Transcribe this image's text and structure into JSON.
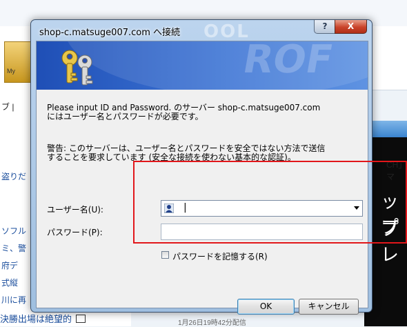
{
  "background": {
    "logo_tab": "My",
    "left_rows": [
      "ブ |",
      "盗りだ",
      "ソフル",
      "ミ、警",
      "府デ",
      "式縦",
      "川に再"
    ],
    "right_text": "CH」マ",
    "right_big": [
      "ップ",
      "プレ"
    ],
    "bottom_link": "決勝出場は絶望的",
    "bottom_meta": "1月26日19時42分配信"
  },
  "dialog": {
    "title": "shop-c.matsuge007.com へ接続",
    "help_label": "?",
    "close_label": "X",
    "message_line1": "Please input ID and Password. のサーバー shop-c.matsuge007.com",
    "message_line2": "にはユーザー名とパスワードが必要です。",
    "warning_line1": "警告: このサーバーは、ユーザー名とパスワードを安全ではない方法で送信",
    "warning_line2": "することを要求しています (安全な接続を使わない基本的な認証)。",
    "username_label": "ユーザー名(U):",
    "username_value": "",
    "password_label": "パスワード(P):",
    "password_value": "",
    "remember_label": "パスワードを記憶する(R)",
    "remember_checked": false,
    "ok_label": "OK",
    "cancel_label": "キャンセル"
  },
  "annotation_color": "#e2161a"
}
